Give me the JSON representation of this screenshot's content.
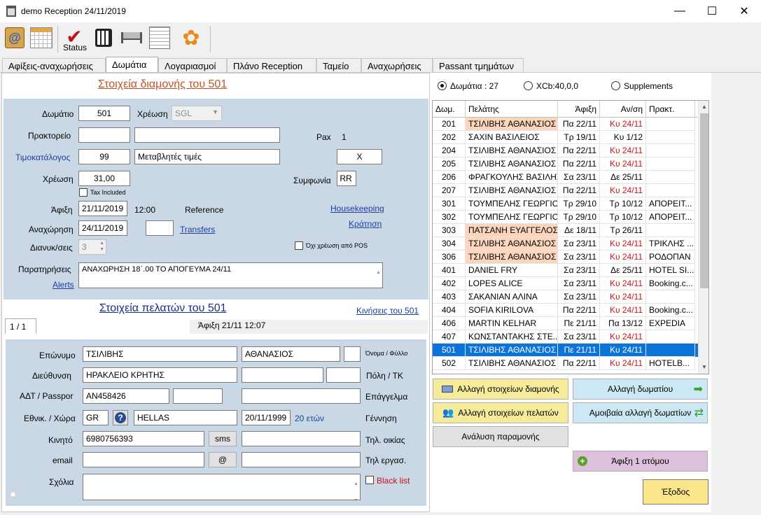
{
  "window": {
    "title": "demo Reception 24/11/2019",
    "minimize": "—",
    "maximize": "☐",
    "close": "✕"
  },
  "toolbar": {
    "status_label": "Status"
  },
  "tabs": [
    "Αφίξεις-αναχωρήσεις",
    "Δωμάτια",
    "Λογαριασμοί",
    "Πλάνο Reception",
    "Ταμείο",
    "Αναχωρήσεις",
    "Passant τμημάτων"
  ],
  "stay": {
    "heading": "Στοιχεία διαμονής του 501",
    "room_label": "Δωμάτιο",
    "room": "501",
    "charge_type_label": "Χρέωση",
    "charge_type": "SGL",
    "agency_label": "Πρακτορείο",
    "pax_label": "Pax",
    "pax": "1",
    "pricelist_label": "Τιμοκατάλογος",
    "pricelist_code": "99",
    "pricelist_name": "Μεταβλητές τιμές",
    "x_value": "X",
    "charge_label": "Χρέωση",
    "charge": "31,00",
    "tax_included": "Tax Included",
    "agreement_label": "Συμφωνία",
    "agreement": "RR",
    "arrival_label": "Άφιξη",
    "arrival_date": "21/11/2019",
    "arrival_time": "12:00",
    "reference_label": "Reference",
    "housekeeping": "Housekeeping",
    "departure_label": "Αναχώρηση",
    "departure_date": "24/11/2019",
    "transfers": "Transfers",
    "reservation": "Κράτηση",
    "nights_label": "Διανυκ/σεις",
    "nights": "3",
    "no_pos": "Όχι χρέωση από POS",
    "notes_label": "Παρατηρήσεις",
    "alerts": "Alerts",
    "notes": "ΑΝΑΧΩΡΗΣΗ 18΄.00 ΤΟ ΑΠΟΓΕΥΜΑ 24/11"
  },
  "guests": {
    "heading": "Στοιχεία πελατών του 501",
    "movements": "Κινήσεις του 501",
    "tab": "1 / 1",
    "arrival": "Άφιξη 21/11 12:07",
    "surname_label": "Επώνυμο",
    "surname": "ΤΣΙΛΙΒΗΣ",
    "firstname": "ΑΘΑΝΑΣΙΟΣ",
    "name_gender_label": "Όνομα / Φύλλο",
    "address_label": "Διεύθυνση",
    "address": "ΗΡΑΚΛΕΙΟ ΚΡΗΤΗΣ",
    "city_label": "Πόλη / ΤΚ",
    "id_label": "ΑΔΤ / Passpor",
    "id": "AN458426",
    "profession_label": "Επάγγελμα",
    "nation_label": "Εθνικ. / Χώρα",
    "nation_code": "GR",
    "country": "HELLAS",
    "birth": "20/11/1999",
    "age": "20 ετών",
    "birth_label": "Γέννηση",
    "mobile_label": "Κινητό",
    "mobile": "6980756393",
    "sms": "sms",
    "home_phone_label": "Τηλ. οικίας",
    "email_label": "email",
    "at": "@",
    "work_phone_label": "Τηλ εργασ.",
    "comments_label": "Σχόλια",
    "blacklist": "Black list"
  },
  "filters": {
    "rooms": "Δωμάτια : 27",
    "xcb": "XCb:40,0,0",
    "supplements": "Supplements"
  },
  "grid": {
    "columns": [
      "Δωμ.",
      "Πελάτης",
      "Άφιξη",
      "Αν/ση",
      "Πρακτ."
    ],
    "rows": [
      {
        "room": "201",
        "guest": "ΤΣΙΛΙΒΗΣ ΑΘΑΝΑΣΙΟΣ",
        "arrival": "Πα 22/11",
        "departure": "Κυ 24/11",
        "agency": "",
        "hl": true,
        "red": true
      },
      {
        "room": "202",
        "guest": "ΣΑΧΙΝ ΒΑΣΙΛΕΙΟΣ",
        "arrival": "Τρ 19/11",
        "departure": "Κυ 1/12",
        "agency": "",
        "hl": false,
        "red": false
      },
      {
        "room": "204",
        "guest": "ΤΣΙΛΙΒΗΣ ΑΘΑΝΑΣΙΟΣ",
        "arrival": "Πα 22/11",
        "departure": "Κυ 24/11",
        "agency": "",
        "hl": false,
        "red": true
      },
      {
        "room": "205",
        "guest": "ΤΣΙΛΙΒΗΣ ΑΘΑΝΑΣΙΟΣ",
        "arrival": "Πα 22/11",
        "departure": "Κυ 24/11",
        "agency": "",
        "hl": false,
        "red": true
      },
      {
        "room": "206",
        "guest": "ΦΡΑΓΚΟΥΛΗΣ ΒΑΣΙΛΗΣ",
        "arrival": "Σα 23/11",
        "departure": "Δε 25/11",
        "agency": "",
        "hl": false,
        "red": false
      },
      {
        "room": "207",
        "guest": "ΤΣΙΛΙΒΗΣ ΑΘΑΝΑΣΙΟΣ",
        "arrival": "Πα 22/11",
        "departure": "Κυ 24/11",
        "agency": "",
        "hl": false,
        "red": true
      },
      {
        "room": "301",
        "guest": "ΤΟΥΜΠΕΛΗΣ ΓΕΩΡΓΙΟΣ",
        "arrival": "Τρ 29/10",
        "departure": "Τρ 10/12",
        "agency": "ΑΠΟΡΕΙΤ...",
        "hl": false,
        "red": false
      },
      {
        "room": "302",
        "guest": "ΤΟΥΜΠΕΛΗΣ ΓΕΩΡΓΙΟΣ",
        "arrival": "Τρ 29/10",
        "departure": "Τρ 10/12",
        "agency": "ΑΠΟΡΕΙΤ...",
        "hl": false,
        "red": false
      },
      {
        "room": "303",
        "guest": "ΠΑΤΣΑΝΗ ΕΥΑΓΓΕΛΟΣ",
        "arrival": "Δε 18/11",
        "departure": "Τρ 26/11",
        "agency": "",
        "hl": true,
        "red": false
      },
      {
        "room": "304",
        "guest": "ΤΣΙΛΙΒΗΣ ΑΘΑΝΑΣΙΟΣ",
        "arrival": "Σα 23/11",
        "departure": "Κυ 24/11",
        "agency": "ΤΡΙΚΛΗΣ ...",
        "hl": true,
        "red": true
      },
      {
        "room": "306",
        "guest": "ΤΣΙΛΙΒΗΣ ΑΘΑΝΑΣΙΟΣ",
        "arrival": "Σα 23/11",
        "departure": "Κυ 24/11",
        "agency": "ΡΟΔΟΠΑΝ",
        "hl": true,
        "red": true
      },
      {
        "room": "401",
        "guest": "DANIEL FRY",
        "arrival": "Σα 23/11",
        "departure": "Δε 25/11",
        "agency": "HOTEL SI...",
        "hl": false,
        "red": false
      },
      {
        "room": "402",
        "guest": "LOPES ALICE",
        "arrival": "Σα 23/11",
        "departure": "Κυ 24/11",
        "agency": "Booking.c...",
        "hl": false,
        "red": true
      },
      {
        "room": "403",
        "guest": "ΣΑΚΑΝΙΑΝ ΑΛΙΝΑ",
        "arrival": "Σα 23/11",
        "departure": "Κυ 24/11",
        "agency": "",
        "hl": false,
        "red": true
      },
      {
        "room": "404",
        "guest": "SOFIA KIRILOVA",
        "arrival": "Πα 22/11",
        "departure": "Κυ 24/11",
        "agency": "Booking.c...",
        "hl": false,
        "red": true
      },
      {
        "room": "406",
        "guest": "MARTIN KELHAR",
        "arrival": "Πε 21/11",
        "departure": "Πα 13/12",
        "agency": "EXPEDIA",
        "hl": false,
        "red": false
      },
      {
        "room": "407",
        "guest": "ΚΩΝΣΤΑΝΤΑΚΗΣ ΣΤΕ...",
        "arrival": "Σα 23/11",
        "departure": "Κυ 24/11",
        "agency": "",
        "hl": false,
        "red": true
      },
      {
        "room": "501",
        "guest": "ΤΣΙΛΙΒΗΣ ΑΘΑΝΑΣΙΟΣ",
        "arrival": "Πε 21/11",
        "departure": "Κυ 24/11",
        "agency": "",
        "hl": false,
        "red": true,
        "sel": true
      },
      {
        "room": "502",
        "guest": "ΤΣΙΛΙΒΗΣ ΑΘΑΝΑΣΙΟΣ",
        "arrival": "Πα 22/11",
        "departure": "Κυ 24/11",
        "agency": "HOTELB...",
        "hl": false,
        "red": true
      }
    ]
  },
  "actions": {
    "change_stay": "Αλλαγή στοιχείων διαμονής",
    "change_room": "Αλλαγή δωματίου",
    "change_guests": "Αλλαγή στοιχείων πελατών",
    "swap_room": "Αμοιβαία αλλαγή δωματίων",
    "stay_analysis": "Ανάλυση παραμονής",
    "arrive_one": "Άφιξη 1 ατόμου",
    "exit": "Έξοδος"
  },
  "colors": {
    "panel_blue": "#cad8e6",
    "highlight_peach": "#fbd5bc",
    "selected_row": "#0a74da",
    "room_change": "#cde8f5",
    "guest_change": "#f6eb9a",
    "arrive": "#dcc0dc",
    "exit": "#fbe68a"
  }
}
